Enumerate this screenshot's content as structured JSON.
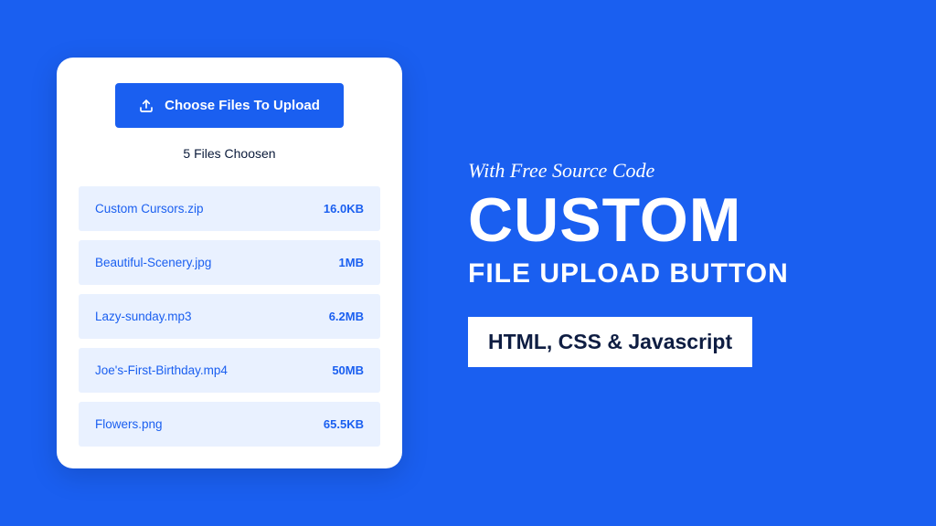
{
  "card": {
    "button_label": "Choose Files To Upload",
    "status_text": "5 Files Choosen",
    "files": [
      {
        "name": "Custom Cursors.zip",
        "size": "16.0KB"
      },
      {
        "name": "Beautiful-Scenery.jpg",
        "size": "1MB"
      },
      {
        "name": "Lazy-sunday.mp3",
        "size": "6.2MB"
      },
      {
        "name": "Joe's-First-Birthday.mp4",
        "size": "50MB"
      },
      {
        "name": "Flowers.png",
        "size": "65.5KB"
      }
    ]
  },
  "headline": {
    "tagline": "With Free Source Code",
    "title_big": "CUSTOM",
    "title_sub": "FILE UPLOAD BUTTON",
    "badge": "HTML, CSS & Javascript"
  }
}
